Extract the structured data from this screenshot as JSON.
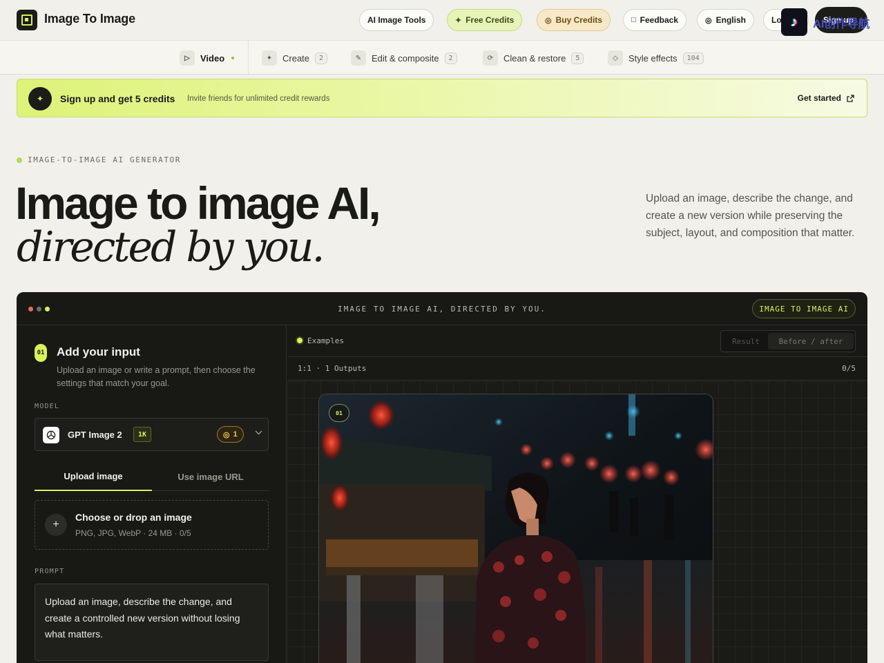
{
  "header": {
    "brand": "Image To Image",
    "nav": {
      "ai_tools": "AI Image Tools",
      "free_credits": "Free Credits",
      "buy_credits": "Buy Credits",
      "feedback": "Feedback",
      "language": "English",
      "login": "Lo",
      "signup": "Sign up"
    }
  },
  "categories": [
    {
      "label": "Video",
      "count": ""
    },
    {
      "label": "Create",
      "count": "2"
    },
    {
      "label": "Edit & composite",
      "count": "2"
    },
    {
      "label": "Clean & restore",
      "count": "5"
    },
    {
      "label": "Style effects",
      "count": "104"
    }
  ],
  "banner": {
    "title": "Sign up and get 5 credits",
    "subtitle": "Invite friends for unlimited credit rewards",
    "cta": "Get started"
  },
  "hero": {
    "eyebrow": "IMAGE-TO-IMAGE AI GENERATOR",
    "title_line1": "Image to image AI,",
    "title_line2": "directed by you.",
    "lead": "Upload an image, describe the change, and create a new version while preserving the subject, layout, and composition that matter."
  },
  "app": {
    "title": "IMAGE TO IMAGE AI, DIRECTED BY YOU.",
    "badge": "IMAGE TO IMAGE AI",
    "left": {
      "step": "01",
      "title": "Add your input",
      "desc": "Upload an image or write a prompt, then choose the settings that match your goal.",
      "model_label": "MODEL",
      "model_name": "GPT Image 2",
      "model_res": "1K",
      "model_cost": "1",
      "tab_upload": "Upload image",
      "tab_url": "Use image URL",
      "drop_title": "Choose or drop an image",
      "drop_sub": "PNG, JPG, WebP · 24 MB · 0/5",
      "prompt_label": "PROMPT",
      "prompt_text": "Upload an image, describe the change, and create a controlled new version without losing what matters."
    },
    "right": {
      "examples": "Examples",
      "seg_result": "Result",
      "seg_before_after": "Before / after",
      "meta_left": "1:1 · 1 Outputs",
      "meta_right": "0/5",
      "output_num": "01"
    }
  },
  "overlay": {
    "text": "AI创作导航"
  },
  "colors": {
    "accent": "#d8f25a",
    "dark": "#181815",
    "page_bg": "#f1f0ea"
  }
}
